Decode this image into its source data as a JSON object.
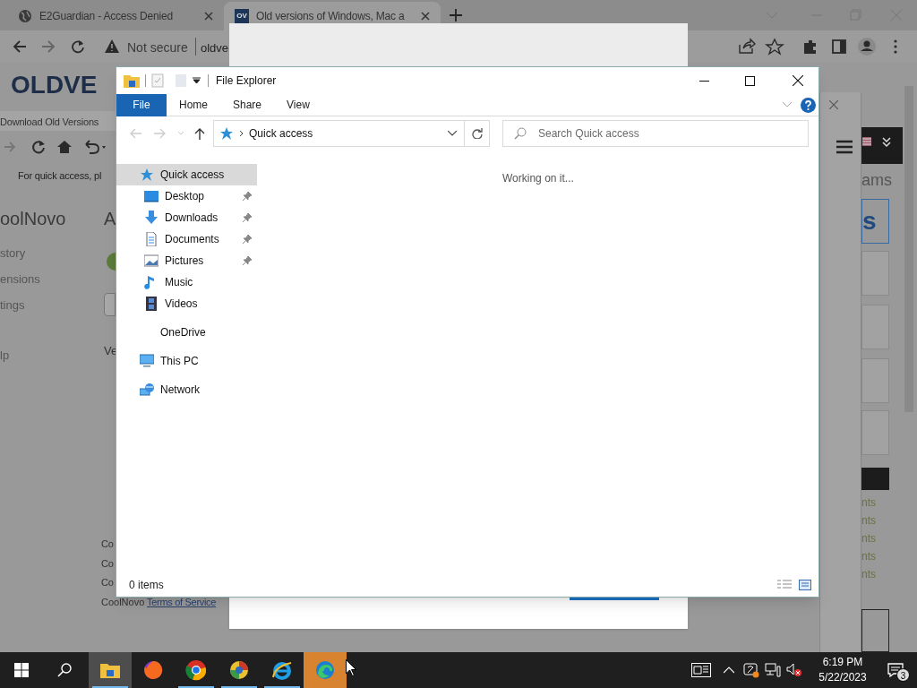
{
  "browser": {
    "tabs": [
      {
        "title": "E2Guardian - Access Denied",
        "kind": "globe",
        "selected": false
      },
      {
        "title": "Old versions of Windows, Mac a",
        "kind": "ov",
        "icon_text": "OV",
        "selected": true
      }
    ],
    "security": "Not secure",
    "url": "oldve"
  },
  "background_page": {
    "logo": "OLDVE",
    "inner_tab": "Download Old Versions",
    "bookmark_hint": "For quick access, pl",
    "sidebar_title": "oolNovo",
    "sidebar_items": [
      "story",
      "ensions",
      "tings",
      "lp"
    ],
    "heading": "A",
    "label": "Ve",
    "footer_lines": [
      "Co",
      "Co",
      "Co"
    ],
    "footer_brand": "CoolNovo",
    "footer_link": "Terms of Service",
    "right_heading": "ams",
    "right_logo": "s",
    "right_links": [
      "nts",
      "nts",
      "nts",
      "nts",
      "nts"
    ]
  },
  "explorer": {
    "title": "File Explorer",
    "ribbon_tabs": [
      {
        "label": "File",
        "selected": true
      },
      {
        "label": "Home",
        "selected": false
      },
      {
        "label": "Share",
        "selected": false
      },
      {
        "label": "View",
        "selected": false
      }
    ],
    "address": "Quick access",
    "search": {
      "placeholder": "Search Quick access"
    },
    "nav": [
      {
        "label": "Quick access",
        "kind": "quick",
        "selected": true,
        "children": [
          {
            "label": "Desktop",
            "kind": "desktop",
            "pinned": true,
            "selected": false
          },
          {
            "label": "Downloads",
            "kind": "downloads",
            "pinned": true,
            "selected": false
          },
          {
            "label": "Documents",
            "kind": "documents",
            "pinned": true,
            "selected": false
          },
          {
            "label": "Pictures",
            "kind": "pictures",
            "pinned": true,
            "selected": false
          },
          {
            "label": "Music",
            "kind": "music",
            "pinned": false,
            "selected": false
          },
          {
            "label": "Videos",
            "kind": "videos",
            "pinned": false,
            "selected": false
          }
        ]
      },
      {
        "label": "OneDrive",
        "kind": "onedrive",
        "selected": false
      },
      {
        "label": "This PC",
        "kind": "pc",
        "selected": false
      },
      {
        "label": "Network",
        "kind": "network",
        "selected": false
      }
    ],
    "content_message": "Working on it...",
    "status": "0 items"
  },
  "taskbar": {
    "apps": [
      {
        "kind": "explorer",
        "selected": true,
        "running": true
      },
      {
        "kind": "firefox",
        "selected": false,
        "running": false
      },
      {
        "kind": "chrome",
        "selected": false,
        "running": true
      },
      {
        "kind": "chromium",
        "selected": false,
        "running": true
      },
      {
        "kind": "ie",
        "selected": false,
        "running": true
      },
      {
        "kind": "edge",
        "selected": false,
        "running": true,
        "flashing": true
      }
    ],
    "time": "6:19 PM",
    "date": "5/22/2023",
    "notifications": "3"
  }
}
